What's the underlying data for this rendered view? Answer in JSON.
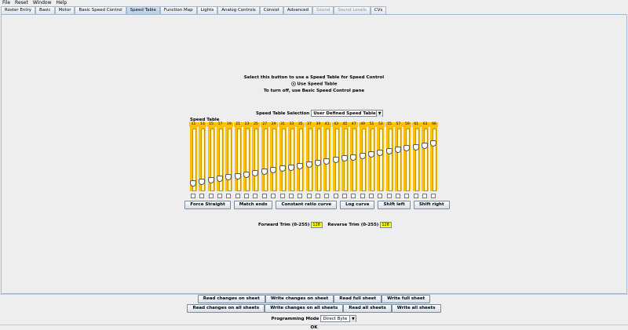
{
  "menu": [
    "File",
    "Reset",
    "Window",
    "Help"
  ],
  "tabs": [
    {
      "label": "Roster Entry",
      "state": "normal"
    },
    {
      "label": "Basic",
      "state": "normal"
    },
    {
      "label": "Motor",
      "state": "normal"
    },
    {
      "label": "Basic Speed Control",
      "state": "normal"
    },
    {
      "label": "Speed Table",
      "state": "selected"
    },
    {
      "label": "Function Map",
      "state": "normal"
    },
    {
      "label": "Lights",
      "state": "normal"
    },
    {
      "label": "Analog Controls",
      "state": "normal"
    },
    {
      "label": "Consist",
      "state": "normal"
    },
    {
      "label": "Advanced",
      "state": "normal"
    },
    {
      "label": "Sound",
      "state": "disabled"
    },
    {
      "label": "Sound Levels",
      "state": "disabled"
    },
    {
      "label": "CVs",
      "state": "normal"
    }
  ],
  "speed_table": {
    "instruction": "Select this button to use a Speed Table for Speed Control",
    "radio_label": "Use Speed Table",
    "turn_off_text": "To turn off, use Basic Speed Control pane",
    "selection_label": "Speed Table Selection",
    "selection_value": "User Defined Speed Table",
    "title": "Speed Table",
    "values": [
      11,
      13,
      15,
      17,
      19,
      21,
      23,
      25,
      27,
      29,
      31,
      33,
      35,
      37,
      39,
      41,
      43,
      45,
      47,
      49,
      51,
      53,
      55,
      57,
      59,
      61,
      63,
      66
    ],
    "buttons": [
      "Force Straight",
      "Match ends",
      "Constant ratio curve",
      "Log curve",
      "Shift left",
      "Shift right"
    ],
    "forward_trim_label": "Forward Trim (0-255)",
    "forward_trim_value": "128",
    "reverse_trim_label": "Reverse Trim (0-255)",
    "reverse_trim_value": "128"
  },
  "sheet_buttons": {
    "row1": [
      "Read changes on sheet",
      "Write changes on sheet",
      "Read full sheet",
      "Write full sheet"
    ],
    "row2": [
      "Read changes on all sheets",
      "Write changes on all sheets",
      "Read all sheets",
      "Write all sheets"
    ]
  },
  "programming": {
    "label": "Programming Mode",
    "value": "Direct Byte"
  },
  "status": "OK",
  "colors": {
    "slider_fill": "#ffc000",
    "trim_field": "#ffff00",
    "selected_tab": "#b8cfe5"
  }
}
